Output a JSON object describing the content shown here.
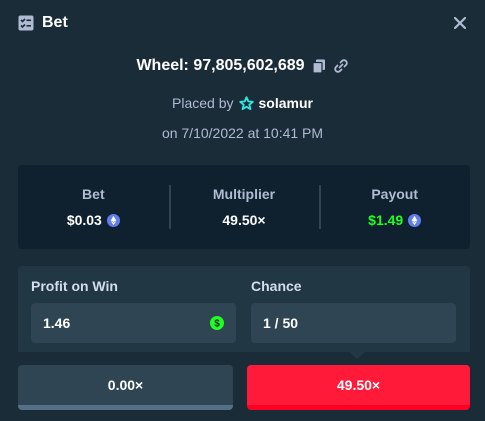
{
  "header": {
    "title": "Bet",
    "title_icon": "bet-list-icon",
    "close_icon": "close-icon"
  },
  "wheel": {
    "text": "Wheel: 97,805,602,689",
    "copy_icon": "copy-icon",
    "link_icon": "link-icon"
  },
  "placed": {
    "prefix": "Placed by",
    "user_icon": "vip-star-icon",
    "username": "solamur"
  },
  "date": "on 7/10/2022 at 10:41 PM",
  "stats": {
    "bet_label": "Bet",
    "bet_value": "$0.03",
    "multiplier_label": "Multiplier",
    "multiplier_value": "49.50×",
    "payout_label": "Payout",
    "payout_value": "$1.49",
    "currency_icon": "ethereum-icon"
  },
  "form": {
    "profit_label": "Profit on Win",
    "profit_value": "1.46",
    "profit_icon": "dollar-coin-icon",
    "chance_label": "Chance",
    "chance_value": "1 / 50"
  },
  "segments": {
    "low": "0.00×",
    "high": "49.50×"
  },
  "colors": {
    "background": "#1a2c38",
    "panel": "#213743",
    "dark_panel": "#0f212e",
    "payout_green": "#1fff20",
    "high_segment": "#ff1a3a",
    "star_accent": "#31e6df",
    "eth_purple": "#627eea"
  }
}
